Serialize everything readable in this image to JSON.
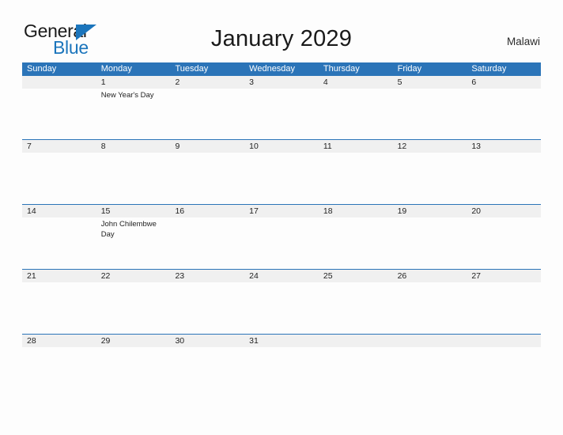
{
  "logo": {
    "word_top": "General",
    "word_bottom": "Blue",
    "triangle_icon": "blue-triangle-icon",
    "brand_color": "#1b75bc"
  },
  "header": {
    "title": "January 2029",
    "country": "Malawi"
  },
  "colors": {
    "header_blue": "#2b74b8",
    "date_band_gray": "#f0f0f0",
    "page_background": "#fdfdfd",
    "text_dark": "#1f1f1f"
  },
  "calendar": {
    "weekdays": [
      "Sunday",
      "Monday",
      "Tuesday",
      "Wednesday",
      "Thursday",
      "Friday",
      "Saturday"
    ],
    "weeks": [
      {
        "days": [
          {
            "date": "",
            "events": []
          },
          {
            "date": "1",
            "events": [
              "New Year's Day"
            ]
          },
          {
            "date": "2",
            "events": []
          },
          {
            "date": "3",
            "events": []
          },
          {
            "date": "4",
            "events": []
          },
          {
            "date": "5",
            "events": []
          },
          {
            "date": "6",
            "events": []
          }
        ]
      },
      {
        "days": [
          {
            "date": "7",
            "events": []
          },
          {
            "date": "8",
            "events": []
          },
          {
            "date": "9",
            "events": []
          },
          {
            "date": "10",
            "events": []
          },
          {
            "date": "11",
            "events": []
          },
          {
            "date": "12",
            "events": []
          },
          {
            "date": "13",
            "events": []
          }
        ]
      },
      {
        "days": [
          {
            "date": "14",
            "events": []
          },
          {
            "date": "15",
            "events": [
              "John Chilembwe Day"
            ]
          },
          {
            "date": "16",
            "events": []
          },
          {
            "date": "17",
            "events": []
          },
          {
            "date": "18",
            "events": []
          },
          {
            "date": "19",
            "events": []
          },
          {
            "date": "20",
            "events": []
          }
        ]
      },
      {
        "days": [
          {
            "date": "21",
            "events": []
          },
          {
            "date": "22",
            "events": []
          },
          {
            "date": "23",
            "events": []
          },
          {
            "date": "24",
            "events": []
          },
          {
            "date": "25",
            "events": []
          },
          {
            "date": "26",
            "events": []
          },
          {
            "date": "27",
            "events": []
          }
        ]
      },
      {
        "days": [
          {
            "date": "28",
            "events": []
          },
          {
            "date": "29",
            "events": []
          },
          {
            "date": "30",
            "events": []
          },
          {
            "date": "31",
            "events": []
          },
          {
            "date": "",
            "events": []
          },
          {
            "date": "",
            "events": []
          },
          {
            "date": "",
            "events": []
          }
        ]
      }
    ]
  }
}
